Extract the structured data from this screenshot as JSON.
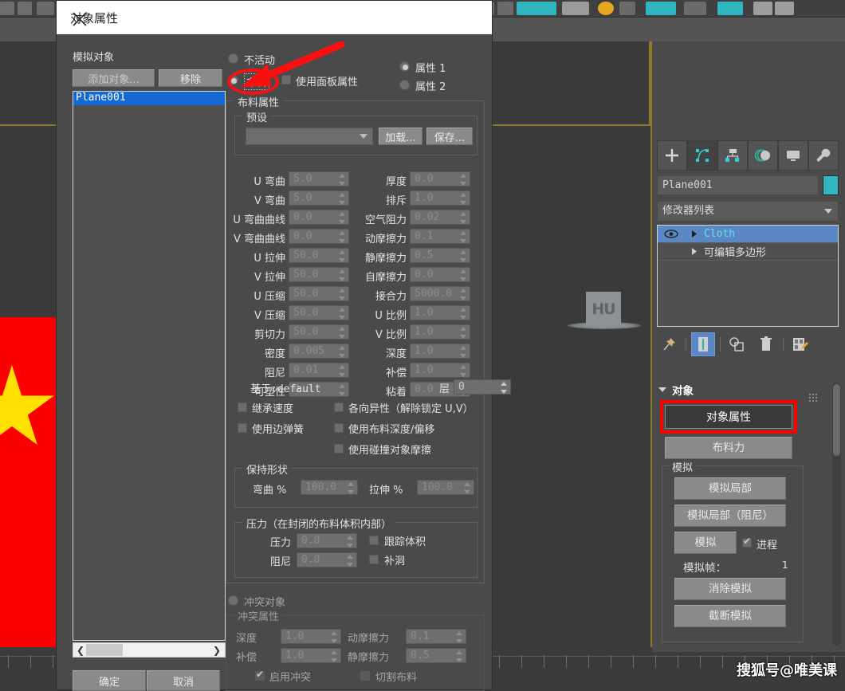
{
  "app": {
    "viewport_object_label": "HU",
    "watermark": "搜狐号@唯美课"
  },
  "command_panel": {
    "tabs": [
      {
        "name": "create-tab",
        "icon": "plus-icon"
      },
      {
        "name": "modify-tab",
        "icon": "modify-icon"
      },
      {
        "name": "hierarchy-tab",
        "icon": "hierarchy-icon"
      },
      {
        "name": "motion-tab",
        "icon": "motion-icon"
      },
      {
        "name": "display-tab",
        "icon": "display-icon"
      },
      {
        "name": "utilities-tab",
        "icon": "wrench-icon"
      }
    ],
    "object_name": "Plane001",
    "modifier_list_label": "修改器列表",
    "stack": [
      {
        "label": "Cloth",
        "selected": true
      },
      {
        "label": "可编辑多边形",
        "selected": false
      }
    ],
    "rollout": {
      "title": "对象",
      "object_properties_button": "对象属性",
      "cloth_forces_button": "布料力",
      "simulation_group": "模拟",
      "simulate_local_button": "模拟局部",
      "simulate_local_damped_button": "模拟局部（阻尼）",
      "simulate_button": "模拟",
      "progress_checkbox": "进程",
      "sim_frame_label": "模拟帧：",
      "sim_frame_value": "1",
      "erase_sim_button": "消除模拟",
      "truncate_sim_button": "截断模拟"
    }
  },
  "dialog": {
    "title": "对象属性",
    "close_icon": "close-icon",
    "sim_objects_label": "模拟对象",
    "add_objects_button": "添加对象...",
    "remove_button": "移除",
    "list_items": [
      "Plane001"
    ],
    "scroll_left_icon": "chevron-left-icon",
    "scroll_right_icon": "chevron-right-icon",
    "ok_button": "确定",
    "cancel_button": "取消",
    "mode": {
      "inactive_label": "不活动",
      "cloth_label": "布料",
      "use_panel_props_label": "使用面板属性",
      "property1_label": "属性 1",
      "property2_label": "属性 2",
      "selected": "cloth",
      "property_selected": "属性 1"
    },
    "cloth_properties": {
      "group_title": "布料属性",
      "preset_group_title": "预设",
      "preset_value": "",
      "load_button": "加载...",
      "save_button": "保存...",
      "left_fields": [
        {
          "label": "U 弯曲",
          "value": "5.0"
        },
        {
          "label": "V 弯曲",
          "value": "5.0"
        },
        {
          "label": "U 弯曲曲线",
          "value": "0.0"
        },
        {
          "label": "V 弯曲曲线",
          "value": "0.0"
        },
        {
          "label": "U 拉伸",
          "value": "50.0"
        },
        {
          "label": "V 拉伸",
          "value": "50.0"
        },
        {
          "label": "U 压缩",
          "value": "50.0"
        },
        {
          "label": "V 压缩",
          "value": "50.0"
        },
        {
          "label": "剪切力",
          "value": "50.0"
        },
        {
          "label": "密度",
          "value": "0.005"
        },
        {
          "label": "阻尼",
          "value": "0.01"
        },
        {
          "label": "可塑性",
          "value": "0.0"
        }
      ],
      "right_fields": [
        {
          "label": "厚度",
          "value": "0.0"
        },
        {
          "label": "排斥",
          "value": "1.0"
        },
        {
          "label": "空气阻力",
          "value": "0.02"
        },
        {
          "label": "动摩擦力",
          "value": "0.1"
        },
        {
          "label": "静摩擦力",
          "value": "0.5"
        },
        {
          "label": "自摩擦力",
          "value": "0.0"
        },
        {
          "label": "接合力",
          "value": "5000.0"
        },
        {
          "label": "U 比例",
          "value": "1.0"
        },
        {
          "label": "V 比例",
          "value": "1.0"
        },
        {
          "label": "深度",
          "value": "1.0"
        },
        {
          "label": "补偿",
          "value": "1.0"
        },
        {
          "label": "粘着",
          "value": "0.0"
        }
      ],
      "based_on_label": "基于:default",
      "layer_label": "层",
      "layer_value": "0",
      "checkboxes": [
        {
          "label": "继承速度",
          "checked": false
        },
        {
          "label": "使用边弹簧",
          "checked": false
        },
        {
          "label": "各向异性（解除锁定 U,V）",
          "checked": false
        },
        {
          "label": "使用布料深度/偏移",
          "checked": false
        },
        {
          "label": "使用碰撞对象摩擦",
          "checked": false
        }
      ],
      "keep_shape": {
        "title": "保持形状",
        "bend_label": "弯曲 %",
        "bend_value": "100.0",
        "stretch_label": "拉伸 %",
        "stretch_value": "100.0"
      },
      "pressure": {
        "title": "压力（在封闭的布料体积内部）",
        "pressure_label": "压力",
        "pressure_value": "0.0",
        "damping_label": "阻尼",
        "damping_value": "0.0",
        "track_volume_label": "跟踪体积",
        "track_volume_checked": false,
        "patch_holes_label": "补洞",
        "patch_holes_checked": false
      }
    },
    "collision": {
      "radio_label": "冲突对象",
      "group_title": "冲突属性",
      "depth_label": "深度",
      "depth_value": "1.0",
      "offset_label": "补偿",
      "offset_value": "1.0",
      "dyn_friction_label": "动摩擦力",
      "dyn_friction_value": "0.1",
      "static_friction_label": "静摩擦力",
      "static_friction_value": "0.5",
      "enable_collision_label": "启用冲突",
      "enable_collision_checked": true,
      "cut_cloth_label": "切割布料",
      "cut_cloth_checked": false
    }
  },
  "annotations": {
    "arrow_color": "#fb0f0f",
    "highlight_color": "#fd0000"
  }
}
